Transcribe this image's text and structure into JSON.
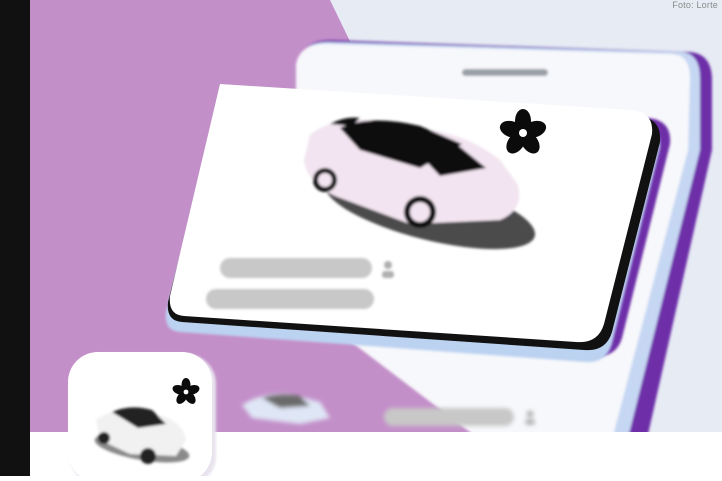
{
  "photo_credit": "Foto: Lorte",
  "colors": {
    "left_strip": "#111111",
    "background_purple": "#c38fc9",
    "phone_back_light": "#e6ebf4",
    "phone_edge_purple": "#6d2fa8",
    "phone_edge_blue": "#bfd3f1",
    "card_white": "#ffffff",
    "placeholder_bar": "#c8c8c8",
    "car_body_pink": "#f2e4f0",
    "car_glass": "#0b0b0b",
    "flower_icon": "#0b0b0b",
    "bottom_panel": "#ffffff"
  },
  "icons": {
    "card_badge": "flower-icon",
    "card_person": "person-icon",
    "tile_badge": "flower-icon",
    "row_person": "person-icon"
  },
  "card": {
    "placeholder_lines": 2
  }
}
